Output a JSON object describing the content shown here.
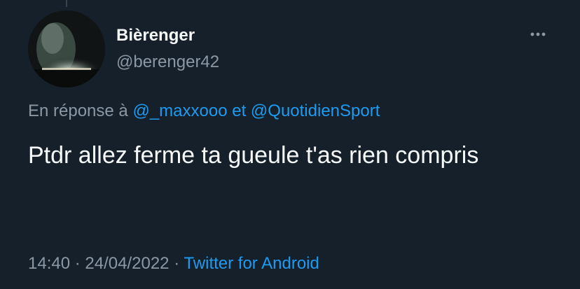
{
  "tweet": {
    "author": {
      "display_name": "Bièrenger",
      "handle": "@berenger42"
    },
    "reply_context": {
      "prefix": "En réponse à",
      "mentions": [
        "@_maxxooo",
        "@QuotidienSport"
      ],
      "conjunction": "et"
    },
    "text": "Ptdr allez ferme ta gueule t'as rien compris",
    "time": "14:40",
    "separator": "·",
    "date": "24/04/2022",
    "source": "Twitter for Android"
  },
  "icons": {
    "more": "more-horizontal-icon"
  },
  "colors": {
    "background": "#15202b",
    "primary_text": "#f7f9f9",
    "secondary_text": "#8b98a5",
    "accent": "#1d9bf0"
  }
}
